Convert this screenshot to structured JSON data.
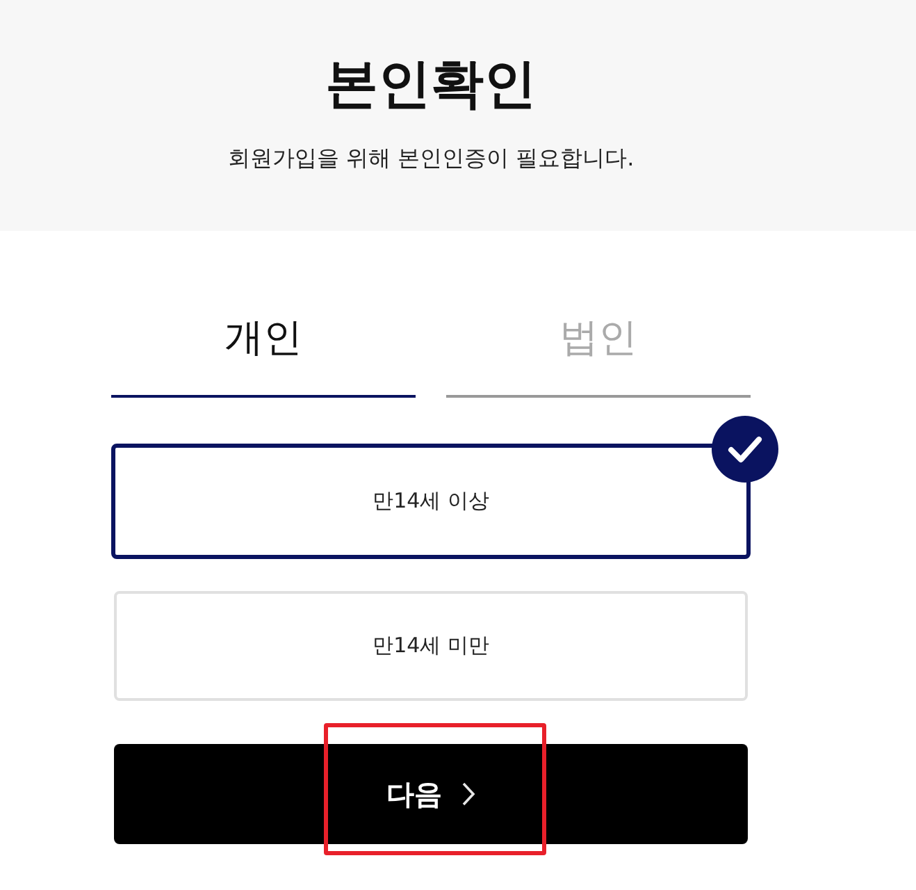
{
  "header": {
    "title": "본인확인",
    "subtitle": "회원가입을 위해 본인인증이 필요합니다."
  },
  "tabs": [
    {
      "label": "개인",
      "selected": true
    },
    {
      "label": "법인",
      "selected": false
    }
  ],
  "options": [
    {
      "label": "만14세 이상",
      "selected": true
    },
    {
      "label": "만14세 미만",
      "selected": false
    }
  ],
  "next_button": {
    "label": "다음",
    "highlighted": true
  }
}
